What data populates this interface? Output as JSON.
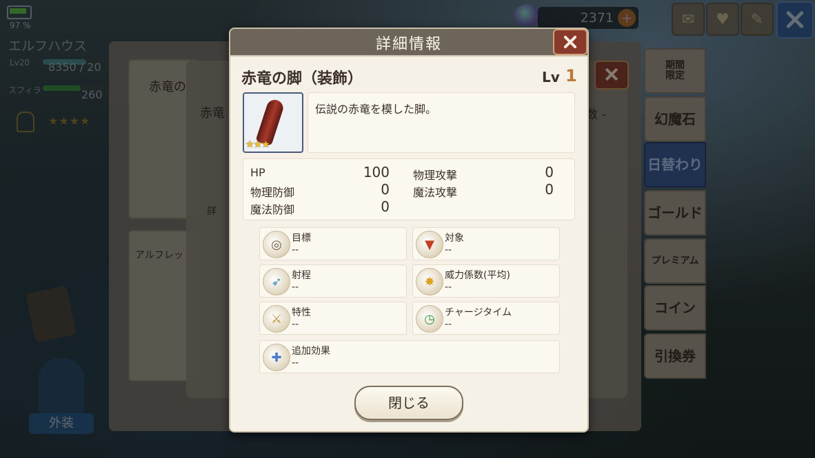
{
  "status": {
    "battery_pct": "97 %",
    "home_name": "エルフハウス",
    "level_label": "Lv20",
    "level_value": "8350 / 20",
    "level_progress": 0.45,
    "sphira_label": "スフィラ",
    "sphira_value": "260",
    "sphira_progress": 0.55,
    "rank_stars": "★★★★"
  },
  "currency": {
    "value": "2371",
    "plus": "+"
  },
  "background": {
    "card1_title": "赤竜の",
    "card2_title": "赤竜",
    "card3_title": "アルフレッ",
    "coef_text": "数 -",
    "details_btn": "詳"
  },
  "side_tabs": [
    {
      "label": "期間\n限定",
      "active": false
    },
    {
      "label": "幻魔石",
      "active": false
    },
    {
      "label": "日替わり",
      "active": true
    },
    {
      "label": "ゴールド",
      "active": false
    },
    {
      "label": "プレミアム",
      "active": false
    },
    {
      "label": "コイン",
      "active": false
    },
    {
      "label": "引換券",
      "active": false
    }
  ],
  "outfit_label": "外装",
  "modal": {
    "title": "詳細情報",
    "item_name": "赤竜の脚（装飾）",
    "lv_label": "Lv",
    "lv_value": "1",
    "thumb_stars": "★★★",
    "description": "伝説の赤竜を模した脚。",
    "stats": {
      "hp_label": "HP",
      "hp_value": "100",
      "pdef_label": "物理防御",
      "pdef_value": "0",
      "mdef_label": "魔法防御",
      "mdef_value": "0",
      "patk_label": "物理攻撃",
      "patk_value": "0",
      "matk_label": "魔法攻撃",
      "matk_value": "0"
    },
    "attributes": [
      {
        "label": "目標",
        "value": "--",
        "icon": "target-icon"
      },
      {
        "label": "対象",
        "value": "--",
        "icon": "area-target-icon"
      },
      {
        "label": "射程",
        "value": "--",
        "icon": "range-icon"
      },
      {
        "label": "威力係数(平均)",
        "value": "--",
        "icon": "power-burst-icon"
      },
      {
        "label": "特性",
        "value": "--",
        "icon": "sword-trait-icon"
      },
      {
        "label": "チャージタイム",
        "value": "--",
        "icon": "charge-clock-icon"
      },
      {
        "label": "追加効果",
        "value": "--",
        "icon": "sword-plus-icon"
      }
    ],
    "close_label": "閉じる"
  },
  "colors": {
    "header": "#6e655a",
    "modal_bg": "#f6f1e6",
    "close_red": "#8a3a2a",
    "level_accent": "#b87a3a",
    "active_tab": "#3a5a90"
  }
}
